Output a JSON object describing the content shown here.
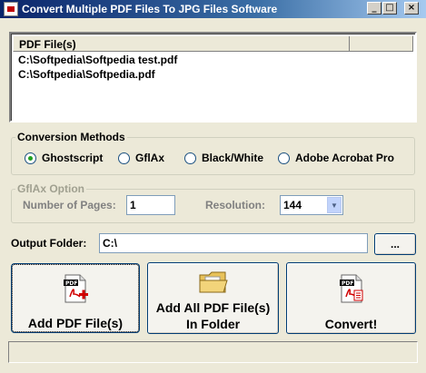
{
  "window": {
    "title": "Convert Multiple PDF Files To JPG Files Software"
  },
  "file_list": {
    "header": "PDF File(s)",
    "rows": [
      "C:\\Softpedia\\Softpedia test.pdf",
      "C:\\Softpedia\\Softpedia.pdf"
    ]
  },
  "conversion": {
    "legend": "Conversion Methods",
    "options": [
      "Ghostscript",
      "GflAx",
      "Black/White",
      "Adobe Acrobat Pro"
    ],
    "selected": "Ghostscript"
  },
  "gflax": {
    "legend": "GflAx Option",
    "pages_label": "Number of Pages:",
    "pages_value": "1",
    "resolution_label": "Resolution:",
    "resolution_value": "144"
  },
  "output": {
    "label": "Output Folder:",
    "value": "C:\\",
    "browse": "..."
  },
  "actions": {
    "add": "Add PDF File(s)",
    "add_folder_line1": "Add All PDF File(s)",
    "add_folder_line2": "In Folder",
    "convert": "Convert!"
  },
  "status": ""
}
